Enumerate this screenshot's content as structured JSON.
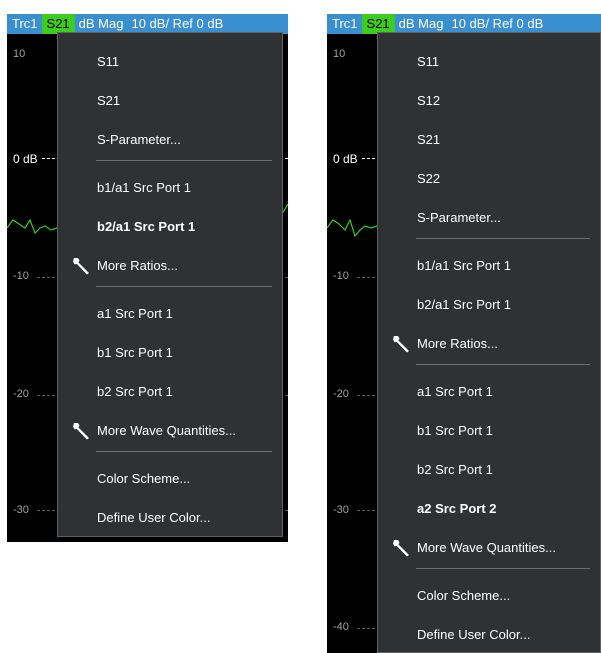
{
  "left": {
    "trace_bar": {
      "trace": "Trc1",
      "sparam": "S21",
      "format": "dB Mag",
      "scale": "10 dB/ Ref 0 dB"
    },
    "y_labels": [
      "10",
      "0 dB",
      "-10",
      "-20",
      "-30"
    ],
    "menu": [
      {
        "label": "S11"
      },
      {
        "label": "S21"
      },
      {
        "label": "S-Parameter..."
      },
      {
        "label": "b1/a1 Src Port 1"
      },
      {
        "label": "b2/a1 Src Port 1",
        "bold": true
      },
      {
        "label": "More Ratios...",
        "icon": "wrench-icon"
      },
      {
        "label": "a1 Src Port 1"
      },
      {
        "label": "b1 Src Port 1"
      },
      {
        "label": "b2 Src Port 1"
      },
      {
        "label": "More Wave Quantities...",
        "icon": "wrench-icon"
      },
      {
        "label": "Color Scheme..."
      },
      {
        "label": "Define User Color..."
      }
    ]
  },
  "right": {
    "trace_bar": {
      "trace": "Trc1",
      "sparam": "S21",
      "format": "dB Mag",
      "scale": "10 dB/ Ref 0 dB"
    },
    "y_labels": [
      "10",
      "0 dB",
      "-10",
      "-20",
      "-30",
      "-40"
    ],
    "menu": [
      {
        "label": "S11"
      },
      {
        "label": "S12"
      },
      {
        "label": "S21"
      },
      {
        "label": "S22"
      },
      {
        "label": "S-Parameter..."
      },
      {
        "label": "b1/a1 Src Port 1"
      },
      {
        "label": "b2/a1 Src Port 1"
      },
      {
        "label": "More Ratios...",
        "icon": "wrench-icon"
      },
      {
        "label": "a1 Src Port 1"
      },
      {
        "label": "b1 Src Port 1"
      },
      {
        "label": "b2 Src Port 1"
      },
      {
        "label": "a2 Src Port 2",
        "bold": true
      },
      {
        "label": "More Wave Quantities...",
        "icon": "wrench-icon"
      },
      {
        "label": "Color Scheme..."
      },
      {
        "label": "Define User Color..."
      }
    ]
  },
  "colors": {
    "trace_bar": "#3a8fd0",
    "sparam_highlight": "#3ccc1e",
    "menu_bg": "#2f3133",
    "trace": "#33cc22"
  }
}
